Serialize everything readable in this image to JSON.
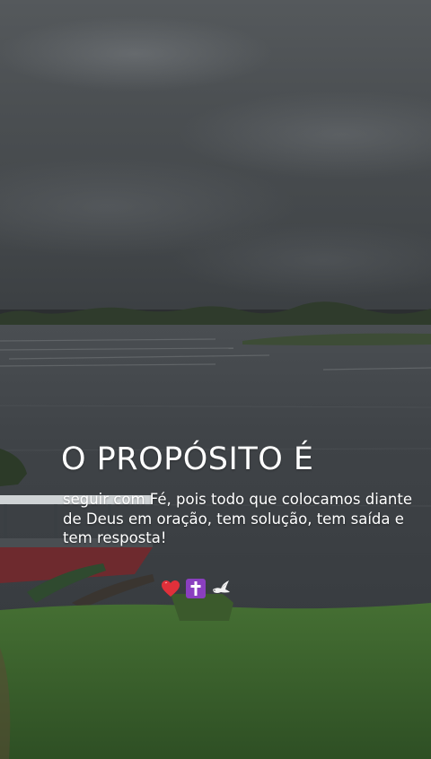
{
  "overlay": {
    "headline": "O PROPÓSITO É",
    "body": "seguir com Fé, pois todo que colocamos diante de Deus em oração, tem solução, tem saída e tem resposta!"
  },
  "emojis": [
    "red-heart",
    "latin-cross-purple-square",
    "white-dove"
  ],
  "colors": {
    "text": "#ffffff",
    "heart": "#e0303a",
    "cross_box": "#8a3fbf",
    "sky": "#4b4f52",
    "water": "#3f4347",
    "grass": "#3e6a2c"
  }
}
